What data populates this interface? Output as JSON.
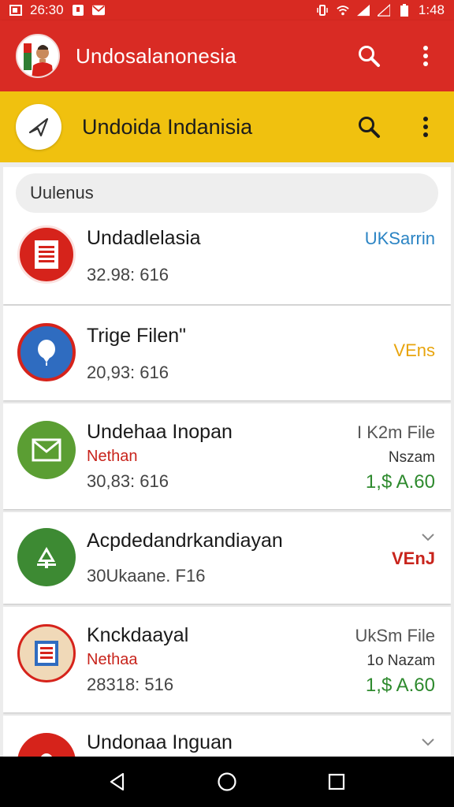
{
  "status_bar": {
    "time_left": "26:30",
    "time_right": "1:48"
  },
  "app_bar": {
    "title": "Undosalanonesia"
  },
  "sub_bar": {
    "title": "Undoida Indanisia"
  },
  "search": {
    "placeholder": "Uulenus"
  },
  "items": [
    {
      "title": "Undadlelasia",
      "meta": "32.98: 616",
      "right_top": "UKSarrin",
      "right_color": "#2b84c4",
      "icon": "document-icon",
      "icon_bg": "#d6231b"
    },
    {
      "title": "Trige Filen\"",
      "meta": "20,93: 616",
      "right_top": "VEns",
      "right_color": "#e8a40c",
      "icon": "balloon-icon",
      "icon_bg": "#2f6cc0"
    },
    {
      "title": "Undehaa Inopan",
      "subtitle": "Nethan",
      "meta": "30,83: 616",
      "right_top": "I K2m File",
      "right_mid": "Nszam",
      "right_price": "1,$ A.60",
      "icon": "mail-icon",
      "icon_bg": "#5b9e33"
    },
    {
      "title": "Acpdedandrkandiayan",
      "meta": "30Ukaane. F16",
      "right_top": "VEnJ",
      "right_color": "#c8241c",
      "icon": "tree-icon",
      "icon_bg": "#3d8a33"
    },
    {
      "title": "Knckdaayal",
      "subtitle": "Nethaa",
      "meta": "28318: 516",
      "right_top": "UkSm File",
      "right_mid": "1o Nazam",
      "right_price": "1,$ A.60",
      "icon": "tablet-icon",
      "icon_bg": "#f0d9b8"
    },
    {
      "title": "Undonaa Inguan",
      "icon": "pin-icon",
      "icon_bg": "#d6231b"
    }
  ]
}
